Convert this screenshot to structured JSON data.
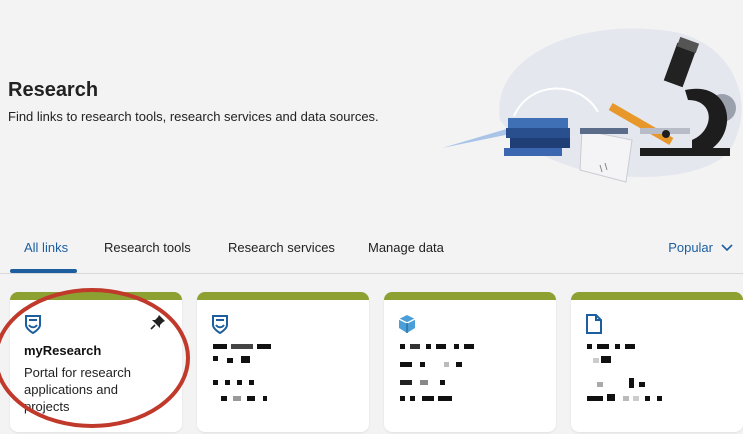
{
  "header": {
    "title": "Research",
    "subtitle": "Find links to research tools, research services and data sources."
  },
  "tabs": [
    {
      "label": "All links",
      "active": true
    },
    {
      "label": "Research tools",
      "active": false
    },
    {
      "label": "Research services",
      "active": false
    },
    {
      "label": "Manage data",
      "active": false
    }
  ],
  "sort": {
    "label": "Popular"
  },
  "cards": [
    {
      "title": "myResearch",
      "description": "Portal for research applications and projects",
      "icon": "shield-icon",
      "pinned": true
    },
    {
      "title": "",
      "description": "",
      "icon": "shield-icon",
      "redacted": true
    },
    {
      "title": "",
      "description": "",
      "icon": "cube-icon",
      "redacted": true
    },
    {
      "title": "",
      "description": "",
      "icon": "document-icon",
      "redacted": true
    }
  ],
  "colors": {
    "accent": "#1c5e9e",
    "card_border": "#8da032",
    "annotation": "#c0392b",
    "background": "#f3f3f4"
  }
}
